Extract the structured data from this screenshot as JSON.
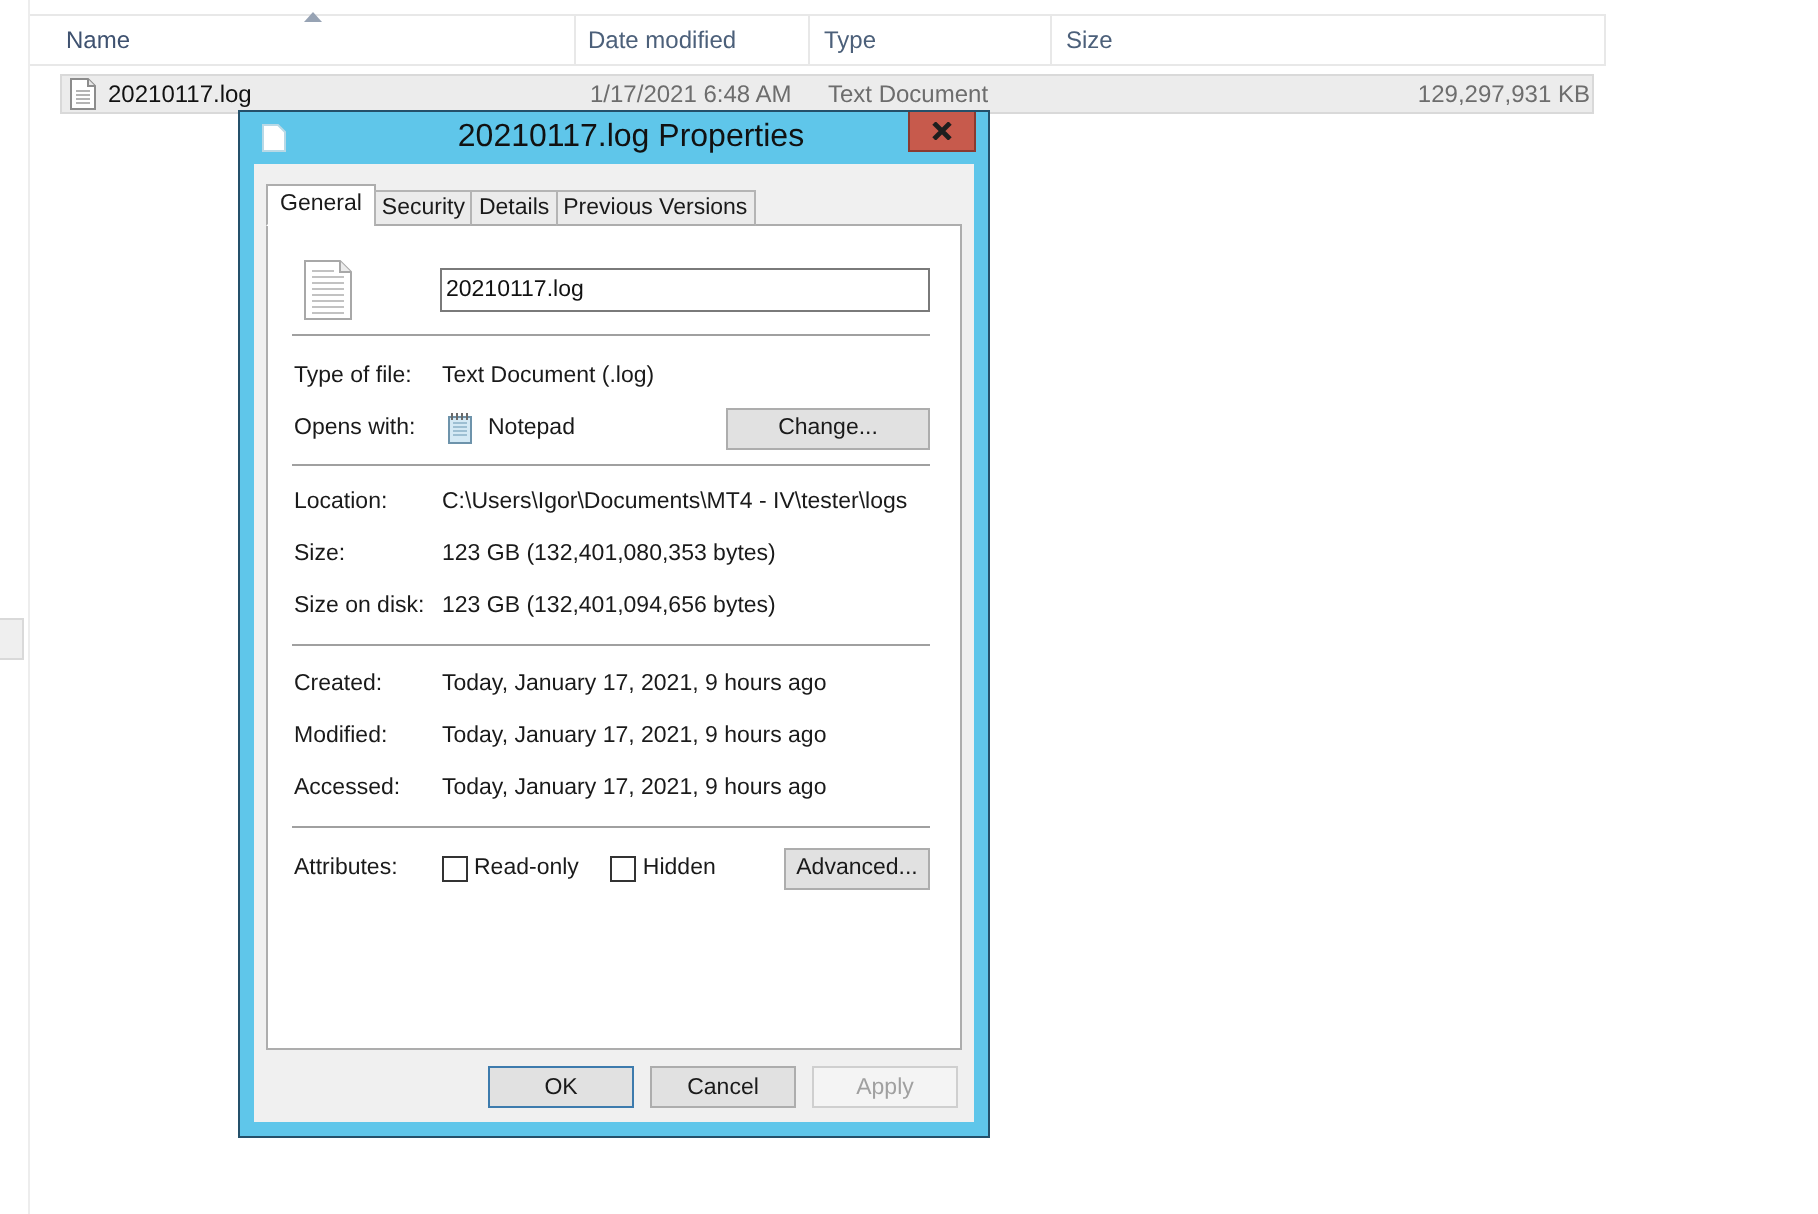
{
  "file_list": {
    "columns": [
      {
        "label": "Name",
        "sorted": true
      },
      {
        "label": "Date modified",
        "sorted": false
      },
      {
        "label": "Type",
        "sorted": false
      },
      {
        "label": "Size",
        "sorted": false
      }
    ],
    "rows": [
      {
        "name": "20210117.log",
        "date_modified": "1/17/2021 6:48 AM",
        "file_type": "Text Document",
        "size": "129,297,931 KB",
        "selected": true
      }
    ]
  },
  "dialog": {
    "title": "20210117.log Properties",
    "tabs": [
      {
        "label": "General",
        "selected": true
      },
      {
        "label": "Security",
        "selected": false
      },
      {
        "label": "Details",
        "selected": false
      },
      {
        "label": "Previous Versions",
        "selected": false
      }
    ],
    "file_name": "20210117.log",
    "type_of_file": {
      "label": "Type of file:",
      "value": "Text Document (.log)"
    },
    "opens_with": {
      "label": "Opens with:",
      "value": "Notepad",
      "button": "Change..."
    },
    "location_rows": [
      {
        "label": "Location:",
        "value": "C:\\Users\\Igor\\Documents\\MT4 - IV\\tester\\logs"
      },
      {
        "label": "Size:",
        "value": "123 GB (132,401,080,353 bytes)"
      },
      {
        "label": "Size on disk:",
        "value": "123 GB (132,401,094,656 bytes)"
      }
    ],
    "date_rows": [
      {
        "label": "Created:",
        "value": "Today, January 17, 2021, 9 hours ago"
      },
      {
        "label": "Modified:",
        "value": "Today, January 17, 2021, 9 hours ago"
      },
      {
        "label": "Accessed:",
        "value": "Today, January 17, 2021, 9 hours ago"
      }
    ],
    "attributes": {
      "label": "Attributes:",
      "options": [
        {
          "label": "Read-only",
          "checked": false
        },
        {
          "label": "Hidden",
          "checked": false
        }
      ],
      "button": "Advanced..."
    },
    "buttons": [
      {
        "label": "OK",
        "default": true,
        "disabled": false
      },
      {
        "label": "Cancel",
        "default": false,
        "disabled": false
      },
      {
        "label": "Apply",
        "default": false,
        "disabled": true
      }
    ]
  }
}
